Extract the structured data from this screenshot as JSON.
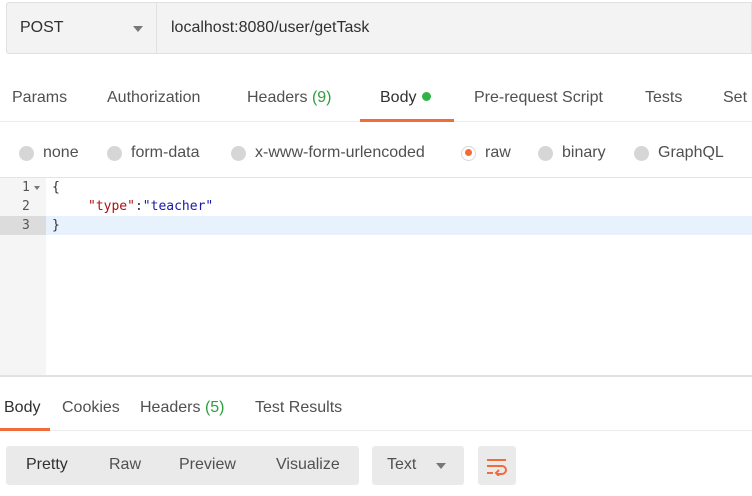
{
  "request": {
    "method": "POST",
    "url": "localhost:8080/user/getTask"
  },
  "request_tabs": [
    {
      "label": "Params"
    },
    {
      "label": "Authorization"
    },
    {
      "label": "Headers",
      "count": "(9)"
    },
    {
      "label": "Body",
      "active": true
    },
    {
      "label": "Pre-request Script"
    },
    {
      "label": "Tests"
    },
    {
      "label": "Set"
    }
  ],
  "body_types": [
    {
      "label": "none"
    },
    {
      "label": "form-data"
    },
    {
      "label": "x-www-form-urlencoded"
    },
    {
      "label": "raw",
      "selected": true
    },
    {
      "label": "binary"
    },
    {
      "label": "GraphQL"
    }
  ],
  "editor": {
    "lines": [
      {
        "num": "1",
        "text": "{"
      },
      {
        "num": "2",
        "key": "\"type\"",
        "sep": ":",
        "value": "\"teacher\""
      },
      {
        "num": "3",
        "text": "}"
      }
    ]
  },
  "response_tabs": [
    {
      "label": "Body",
      "active": true
    },
    {
      "label": "Cookies"
    },
    {
      "label": "Headers",
      "count": "(5)"
    },
    {
      "label": "Test Results"
    }
  ],
  "response_views": [
    {
      "label": "Pretty",
      "active": true
    },
    {
      "label": "Raw"
    },
    {
      "label": "Preview"
    },
    {
      "label": "Visualize"
    }
  ],
  "format_select": {
    "value": "Text"
  },
  "colors": {
    "accent": "#f26b3a",
    "success": "#2e9e3e"
  },
  "icons": {
    "wrap": "wrap-lines-icon",
    "caret": "chevron-down-icon"
  }
}
